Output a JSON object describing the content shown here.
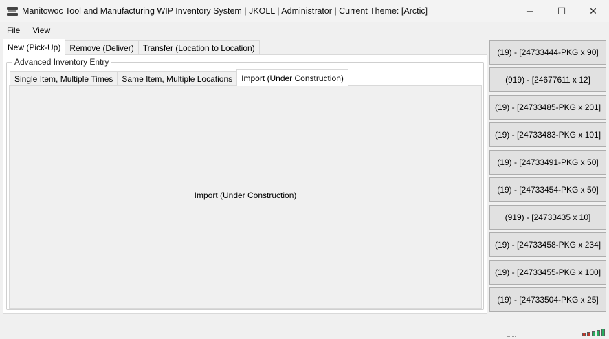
{
  "window": {
    "title": "Manitowoc Tool and Manufacturing WIP Inventory System | JKOLL | Administrator | Current Theme: [Arctic]",
    "minimize_glyph": "─",
    "maximize_glyph": "☐",
    "close_glyph": "✕"
  },
  "menu": {
    "items": [
      "File",
      "View"
    ]
  },
  "top_tabs": [
    "New (Pick-Up)",
    "Remove (Deliver)",
    "Transfer (Location to Location)"
  ],
  "group": {
    "title": "Advanced Inventory Entry"
  },
  "inner_tabs": [
    "Single Item, Multiple Times",
    "Same Item, Multiple Locations",
    "Import (Under Construction)"
  ],
  "import_panel": {
    "label": "Import (Under Construction)"
  },
  "queue_buttons": [
    "(19) - [24733444-PKG x 90]",
    "(919) - [24677611 x 12]",
    "(19) - [24733485-PKG x 201]",
    "(19) - [24733483-PKG x 101]",
    "(19) - [24733491-PKG x 50]",
    "(19) - [24733454-PKG x 50]",
    "(919) - [24733435 x 10]",
    "(19) - [24733458-PKG x 234]",
    "(19) - [24733455-PKG x 100]",
    "(19) - [24733504-PKG x 25]",
    ""
  ],
  "status": {
    "signal_colors": [
      "#c0392b",
      "#c0392b",
      "#27ae60",
      "#27ae60",
      "#27ae60"
    ]
  }
}
